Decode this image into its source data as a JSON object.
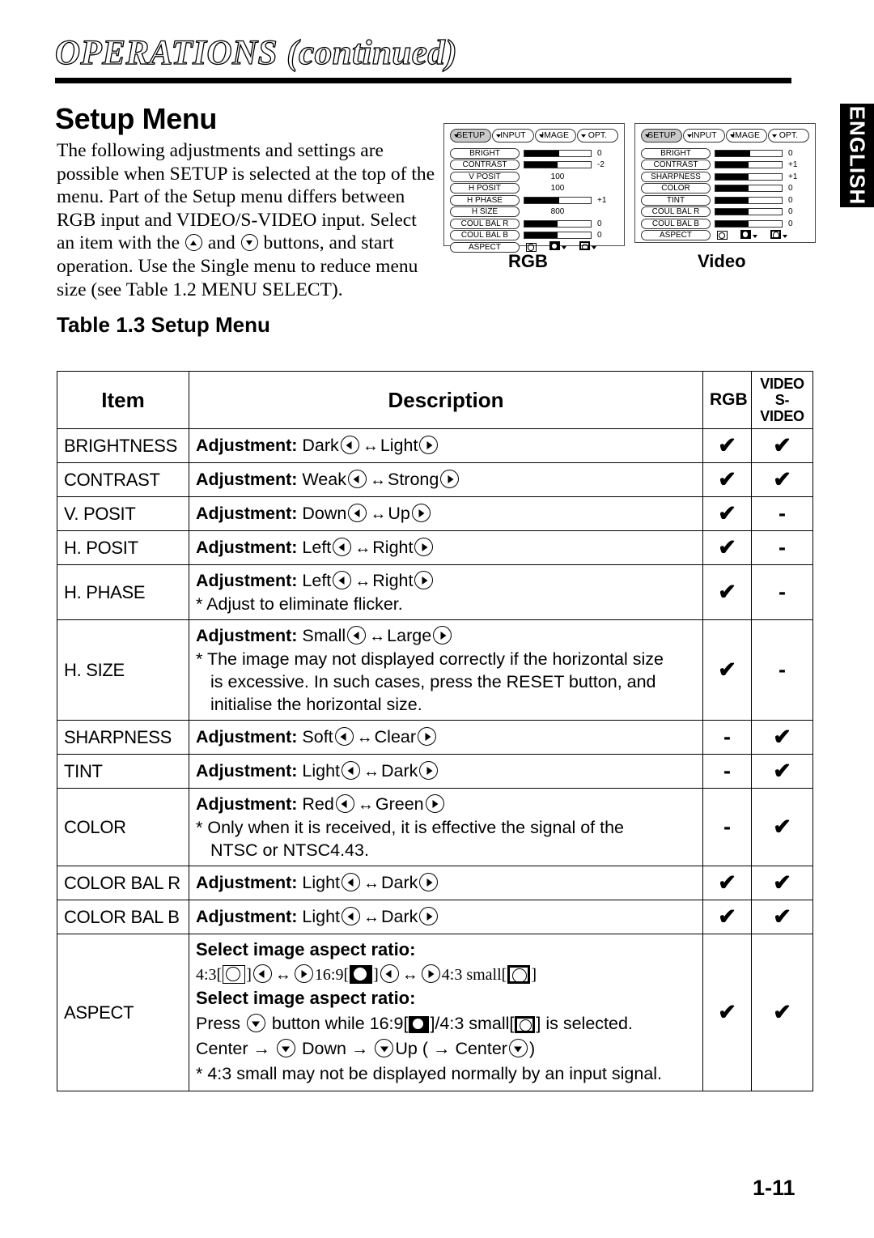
{
  "header": {
    "chapter_title": "OPERATIONS (continued)",
    "section_title": "Setup Menu",
    "side_tab": "ENGLISH",
    "page_number": "1-11"
  },
  "intro": {
    "p1": "The following adjustments and settings are possible when SETUP is selected at the top of the menu. Part of the Setup menu differs between RGB input and VIDEO/S-VIDEO input. Select an item with the",
    "p2": "and",
    "p3": "buttons, and start operation. Use the Single menu to reduce menu size (see Table 1.2 MENU SELECT).",
    "table_caption": "Table 1.3 Setup Menu"
  },
  "osd": {
    "tabs": [
      "SETUP",
      "INPUT",
      "IMAGE",
      "OPT."
    ],
    "active_tab": "SETUP",
    "rgb": {
      "caption": "RGB",
      "rows": [
        {
          "label": "BRIGHT",
          "type": "bar",
          "fill": 52,
          "value": "0"
        },
        {
          "label": "CONTRAST",
          "type": "bar",
          "fill": 50,
          "value": "-2"
        },
        {
          "label": "V POSIT",
          "type": "num",
          "value": "100"
        },
        {
          "label": "H POSIT",
          "type": "num",
          "value": "100"
        },
        {
          "label": "H PHASE",
          "type": "bar",
          "fill": 52,
          "value": "+1"
        },
        {
          "label": "H SIZE",
          "type": "num",
          "value": "800"
        },
        {
          "label": "COUL BAL  R",
          "type": "bar",
          "fill": 50,
          "value": "0"
        },
        {
          "label": "COUL BAL  B",
          "type": "bar",
          "fill": 50,
          "value": "0"
        },
        {
          "label": "ASPECT",
          "type": "aspect",
          "value": ""
        }
      ]
    },
    "video": {
      "caption": "Video",
      "rows": [
        {
          "label": "BRIGHT",
          "type": "bar",
          "fill": 52,
          "value": "0"
        },
        {
          "label": "CONTRAST",
          "type": "bar",
          "fill": 50,
          "value": "+1"
        },
        {
          "label": "SHARPNESS",
          "type": "bar",
          "fill": 50,
          "value": "+1"
        },
        {
          "label": "COLOR",
          "type": "bar",
          "fill": 50,
          "value": "0"
        },
        {
          "label": "TINT",
          "type": "bar",
          "fill": 50,
          "value": "0"
        },
        {
          "label": "COUL BAL  R",
          "type": "bar",
          "fill": 50,
          "value": "0"
        },
        {
          "label": "COUL BAL  B",
          "type": "bar",
          "fill": 50,
          "value": "0"
        },
        {
          "label": "ASPECT",
          "type": "aspect",
          "value": ""
        }
      ]
    }
  },
  "table": {
    "headers": {
      "item": "Item",
      "description": "Description",
      "rgb": "RGB",
      "video_line1": "VIDEO",
      "video_line2": "S-VIDEO"
    },
    "rows": [
      {
        "item": "BRIGHTNESS",
        "adjust_label": "Adjustment:",
        "left_word": "Dark",
        "right_word": "Light",
        "notes": [],
        "rgb": "✔",
        "video": "✔"
      },
      {
        "item": "CONTRAST",
        "adjust_label": "Adjustment:",
        "left_word": "Weak",
        "right_word": "Strong",
        "notes": [],
        "rgb": "✔",
        "video": "✔"
      },
      {
        "item": "V. POSIT",
        "adjust_label": "Adjustment:",
        "left_word": "Down",
        "right_word": "Up",
        "notes": [],
        "rgb": "✔",
        "video": "-"
      },
      {
        "item": "H. POSIT",
        "adjust_label": "Adjustment:",
        "left_word": "Left",
        "right_word": "Right",
        "notes": [],
        "rgb": "✔",
        "video": "-"
      },
      {
        "item": "H. PHASE",
        "adjust_label": "Adjustment:",
        "left_word": "Left",
        "right_word": "Right",
        "notes": [
          "* Adjust to eliminate flicker."
        ],
        "rgb": "✔",
        "video": "-"
      },
      {
        "item": "H. SIZE",
        "adjust_label": "Adjustment:",
        "left_word": "Small",
        "right_word": "Large",
        "notes": [
          "* The image may not displayed correctly if the horizontal size",
          "is excessive. In such cases, press the RESET button, and",
          "initialise the horizontal size."
        ],
        "rgb": "✔",
        "video": "-"
      },
      {
        "item": "SHARPNESS",
        "adjust_label": "Adjustment:",
        "left_word": "Soft",
        "right_word": "Clear",
        "notes": [],
        "rgb": "-",
        "video": "✔"
      },
      {
        "item": "TINT",
        "adjust_label": "Adjustment:",
        "left_word": "Light",
        "right_word": "Dark",
        "notes": [],
        "rgb": "-",
        "video": "✔"
      },
      {
        "item": "COLOR",
        "adjust_label": "Adjustment:",
        "left_word": "Red",
        "right_word": "Green",
        "notes": [
          "* Only when it is received, it is effective the signal of the",
          "NTSC or NTSC4.43."
        ],
        "rgb": "-",
        "video": "✔"
      },
      {
        "item": "COLOR BAL R",
        "adjust_label": "Adjustment:",
        "left_word": "Light",
        "right_word": "Dark",
        "notes": [],
        "rgb": "✔",
        "video": "✔"
      },
      {
        "item": "COLOR BAL B",
        "adjust_label": "Adjustment:",
        "left_word": "Light",
        "right_word": "Dark",
        "notes": [],
        "rgb": "✔",
        "video": "✔"
      }
    ],
    "aspect_row": {
      "item": "ASPECT",
      "heading1": "Select image aspect ratio:",
      "ratio_43": "4:3[",
      "ratio_43_close": "]",
      "ratio_169": "16:9[",
      "ratio_169_close": "]",
      "ratio_43_small": "4:3 small[",
      "ratio_43_small_close": "]",
      "heading2": "Select image aspect ratio:",
      "press_line_a": "Press",
      "press_line_b": "button while 16:9[",
      "press_line_c": "]/4:3 small[",
      "press_line_d": "] is selected.",
      "center_line_a": "Center",
      "center_line_b": "Down",
      "center_line_c": "Up (",
      "center_line_d": "Center",
      "center_line_e": ")",
      "note": "* 4:3 small may not be displayed normally by an input signal.",
      "rgb": "✔",
      "video": "✔"
    }
  }
}
